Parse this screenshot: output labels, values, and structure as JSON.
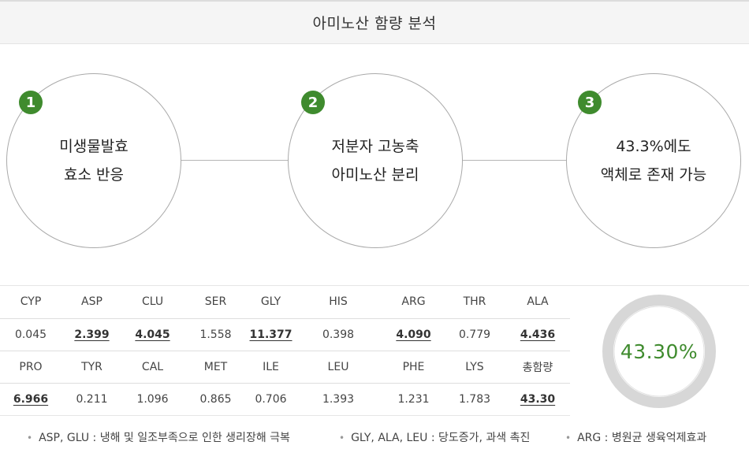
{
  "header": {
    "title": "아미노산 함량 분석"
  },
  "steps": [
    {
      "number": "1",
      "line1": "미생물발효",
      "line2": "효소 반응"
    },
    {
      "number": "2",
      "line1": "저분자 고농축",
      "line2": "아미노산 분리"
    },
    {
      "number": "3",
      "line1": "43.3%에도",
      "line2": "액체로 존재 가능"
    }
  ],
  "table": {
    "row1_headers": [
      "CYP",
      "ASP",
      "CLU",
      "SER",
      "GLY",
      "HIS",
      "ARG",
      "THR",
      "ALA"
    ],
    "row1_values": [
      "0.045",
      "2.399",
      "4.045",
      "1.558",
      "11.377",
      "0.398",
      "4.090",
      "0.779",
      "4.436"
    ],
    "row2_headers": [
      "PRO",
      "TYR",
      "CAL",
      "MET",
      "ILE",
      "LEU",
      "PHE",
      "LYS",
      "총함량"
    ],
    "row2_values": [
      "6.966",
      "0.211",
      "1.096",
      "0.865",
      "0.706",
      "1.393",
      "1.231",
      "1.783",
      "43.30"
    ],
    "highlight_row1": [
      false,
      true,
      true,
      false,
      true,
      false,
      true,
      false,
      true
    ],
    "highlight_row2": [
      true,
      false,
      false,
      false,
      false,
      false,
      false,
      false,
      true
    ]
  },
  "gauge": {
    "label": "43.30%",
    "value": 43.3,
    "color": "#3f8b2e",
    "track_color": "#d7d7d7"
  },
  "notes": [
    "ASP, GLU : 냉해 및 일조부족으로 인한 생리장해 극복",
    "GLY, ALA, LEU : 당도증가, 과색 촉진",
    "ARG : 병원균 생육억제효과"
  ],
  "colors": {
    "accent": "#3f8b2e",
    "circle_border": "#a9a9a9"
  }
}
